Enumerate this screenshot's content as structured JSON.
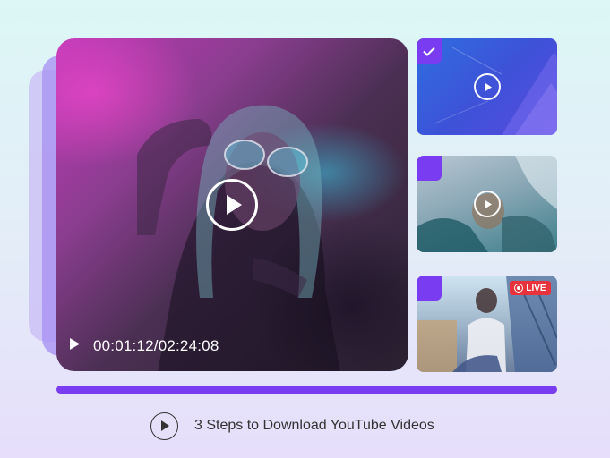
{
  "player": {
    "time_display": "00:01:12/02:24:08",
    "icons": {
      "play": "play-icon",
      "play_circle": "play-circle-icon"
    }
  },
  "thumbnails": [
    {
      "id": "thumb-1",
      "selected": true,
      "icon": "check-icon"
    },
    {
      "id": "thumb-2",
      "selected": false
    },
    {
      "id": "thumb-3",
      "selected": false,
      "badge": "LIVE"
    }
  ],
  "progress": {
    "fraction": 1.0
  },
  "caption": {
    "text": "3 Steps to Download YouTube Videos"
  },
  "colors": {
    "accent": "#7a3cf0",
    "live": "#e8323c",
    "text": "#333333"
  }
}
